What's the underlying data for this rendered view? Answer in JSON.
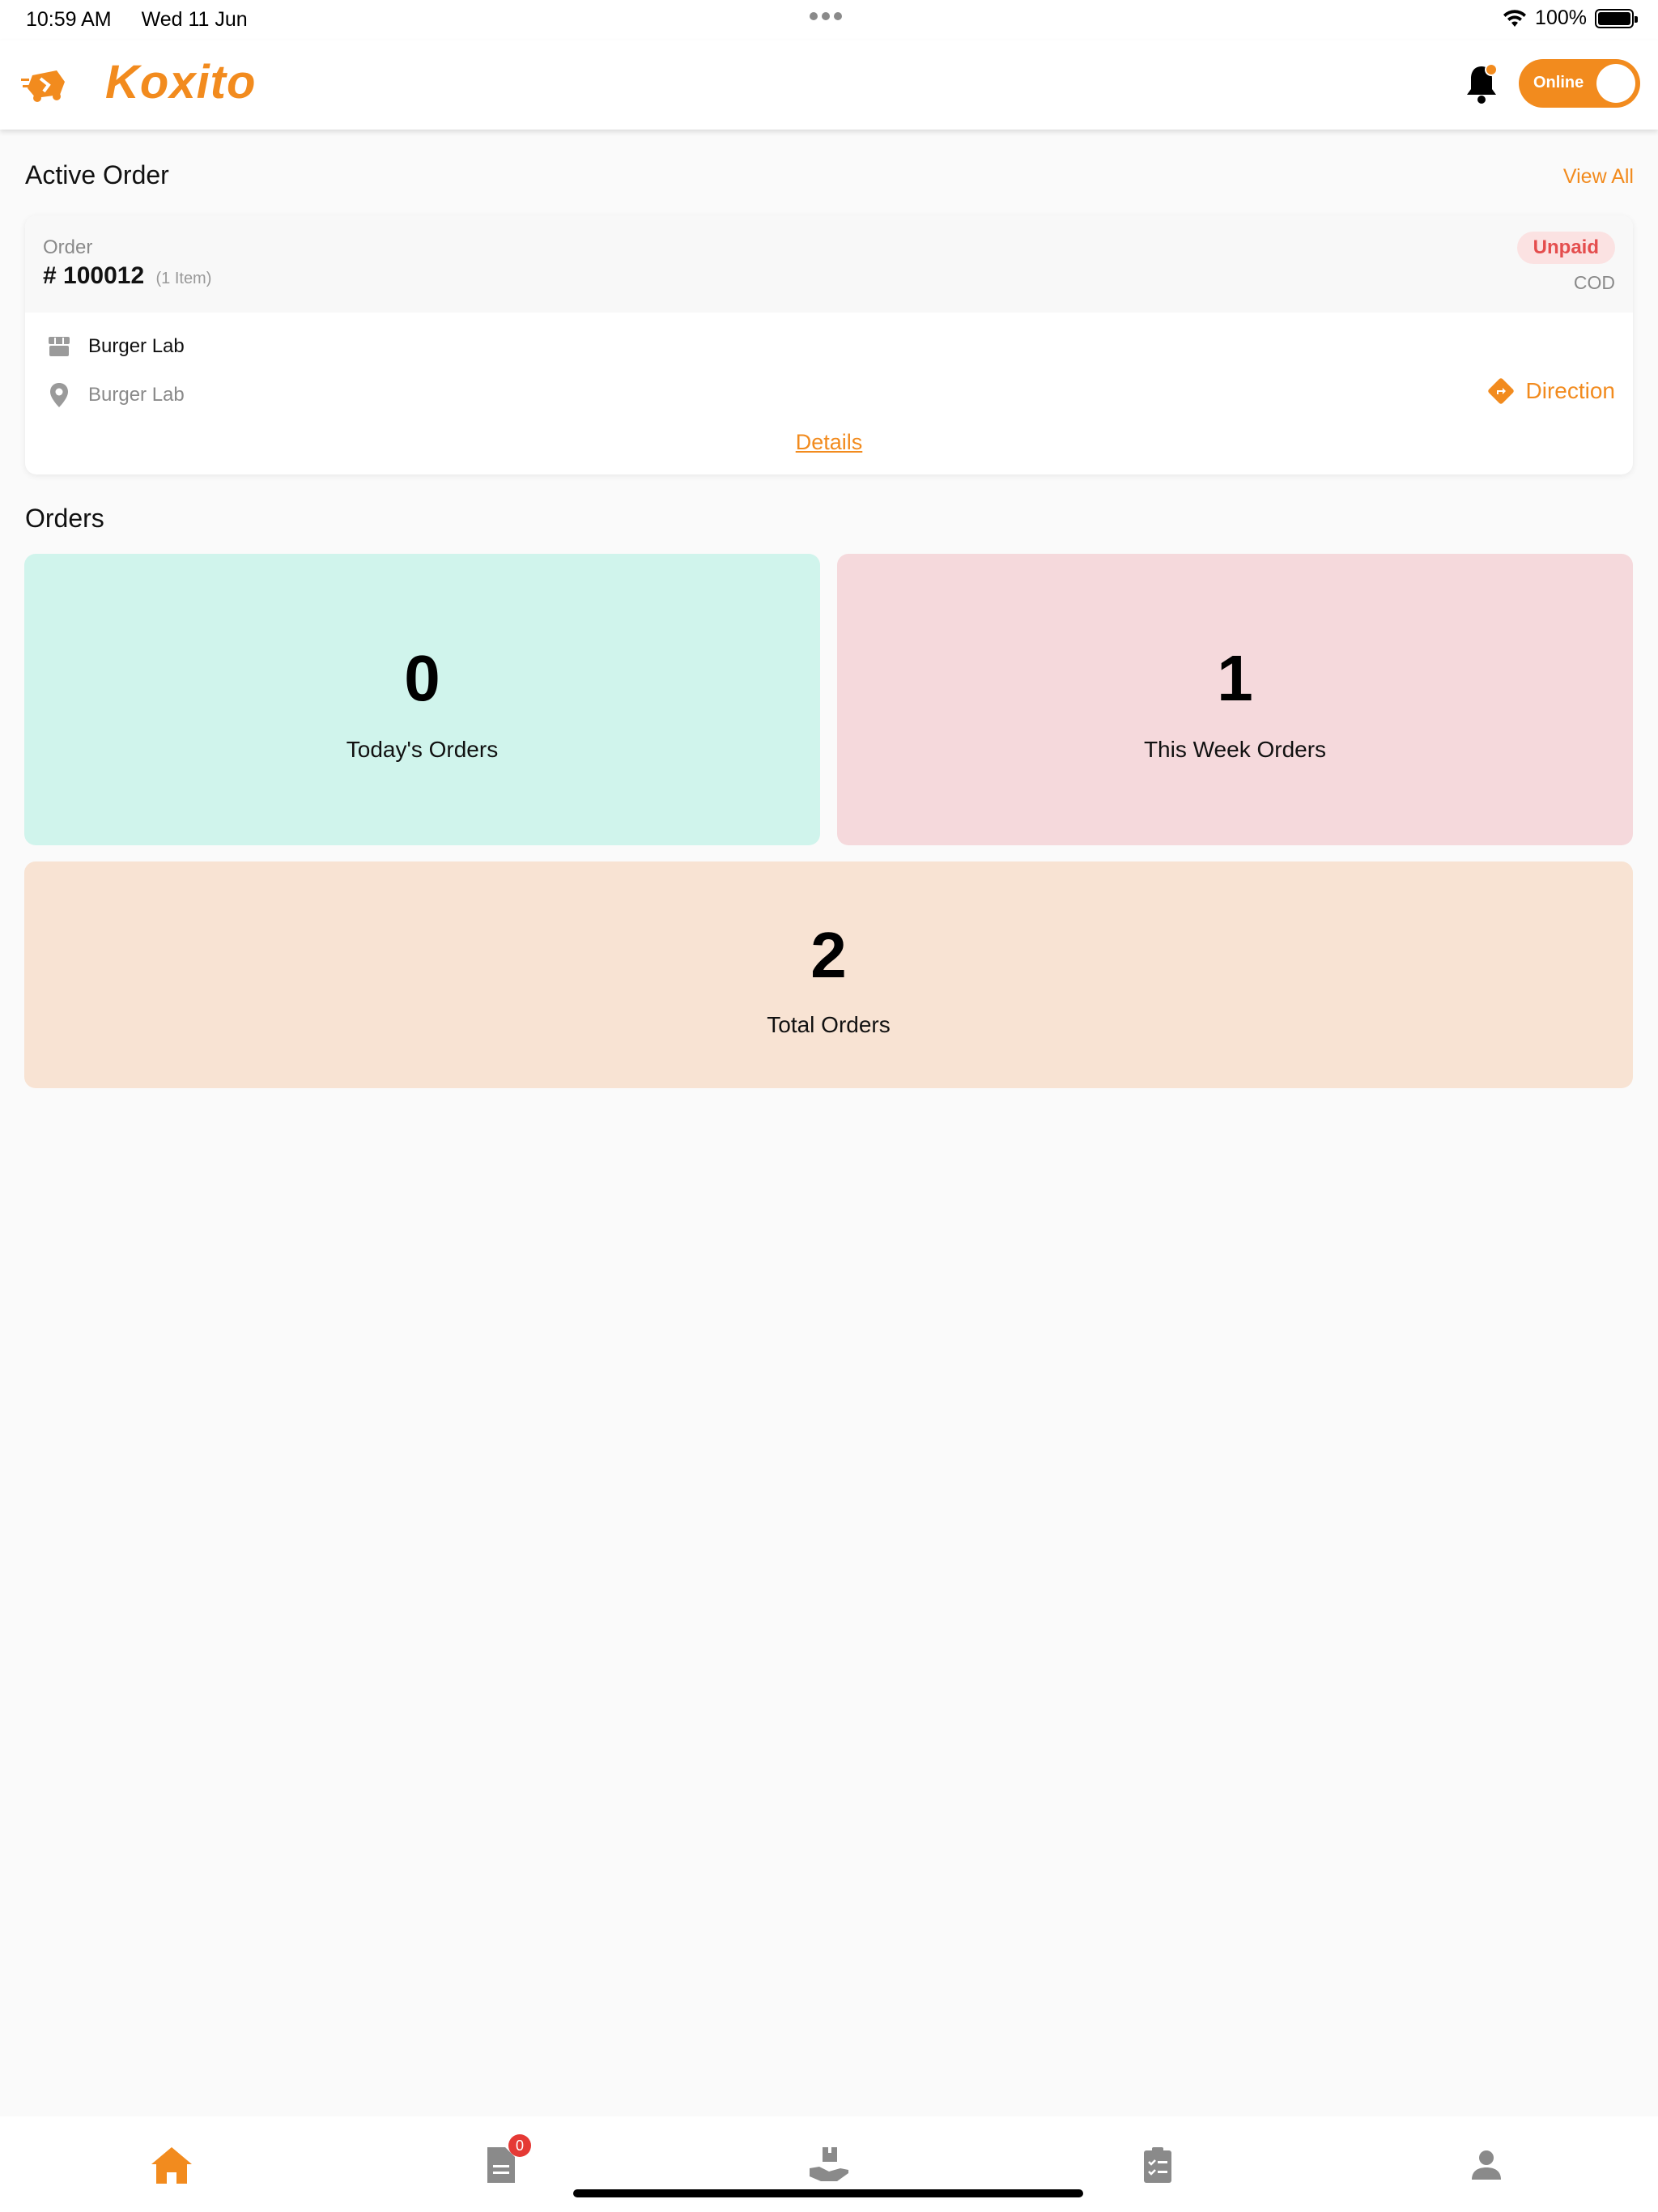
{
  "status_bar": {
    "time": "10:59 AM",
    "date": "Wed 11 Jun",
    "battery": "100%"
  },
  "header": {
    "brand": "Koxito",
    "online_label": "Online",
    "notification_icon": "bell-icon",
    "accent_color": "#f28b1e"
  },
  "active_order": {
    "section_title": "Active Order",
    "view_all": "View All",
    "order_caption": "Order",
    "order_number": "# 100012",
    "item_count": "(1 Item)",
    "payment_status": "Unpaid",
    "payment_method": "COD",
    "restaurant": "Burger Lab",
    "location": "Burger Lab",
    "direction_label": "Direction",
    "details_label": "Details"
  },
  "orders": {
    "section_title": "Orders",
    "today": {
      "value": "0",
      "label": "Today's Orders",
      "color": "#d0f4ec"
    },
    "week": {
      "value": "1",
      "label": "This Week Orders",
      "color": "#f5d9dc"
    },
    "total": {
      "value": "2",
      "label": "Total Orders",
      "color": "#f8e3d3"
    }
  },
  "bottom_nav": {
    "items": [
      "home-icon",
      "orders-icon",
      "delivery-icon",
      "checklist-icon",
      "profile-icon"
    ],
    "orders_badge": "0",
    "active_item": "home-icon",
    "active_color": "#f28b1e",
    "inactive_color": "#8a8a8a"
  }
}
